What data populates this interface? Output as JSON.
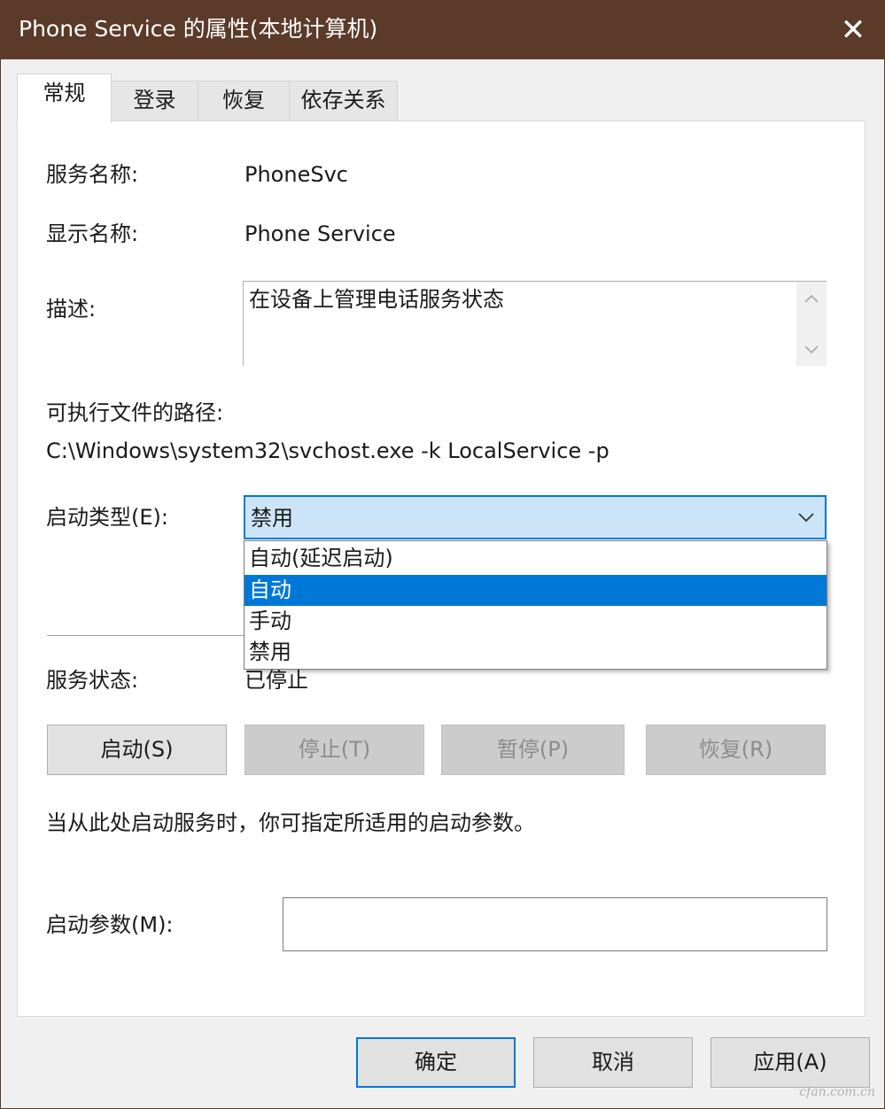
{
  "window": {
    "title": "Phone Service 的属性(本地计算机)",
    "close_glyph": "✕"
  },
  "tabs": [
    {
      "label": "常规",
      "active": true
    },
    {
      "label": "登录",
      "active": false
    },
    {
      "label": "恢复",
      "active": false
    },
    {
      "label": "依存关系",
      "active": false
    }
  ],
  "general": {
    "service_name_label": "服务名称:",
    "service_name_value": "PhoneSvc",
    "display_name_label": "显示名称:",
    "display_name_value": "Phone Service",
    "description_label": "描述:",
    "description_value": "在设备上管理电话服务状态",
    "exe_path_label": "可执行文件的路径:",
    "exe_path_value": "C:\\Windows\\system32\\svchost.exe -k LocalService -p",
    "startup_type_label": "启动类型(E):",
    "startup_type_value": "禁用",
    "startup_options": [
      "自动(延迟启动)",
      "自动",
      "手动",
      "禁用"
    ],
    "startup_highlighted_index": 1,
    "service_status_label": "服务状态:",
    "service_status_value": "已停止",
    "buttons": {
      "start": "启动(S)",
      "stop": "停止(T)",
      "pause": "暂停(P)",
      "resume": "恢复(R)"
    },
    "hint": "当从此处启动服务时，你可指定所适用的启动参数。",
    "start_params_label": "启动参数(M):",
    "start_params_value": ""
  },
  "footer": {
    "ok": "确定",
    "cancel": "取消",
    "apply": "应用(A)"
  },
  "watermark": "cfan.com.cn",
  "colors": {
    "titlebar": "#5b3a29",
    "accent": "#0078d7",
    "combo_bg": "#cce4f7"
  }
}
